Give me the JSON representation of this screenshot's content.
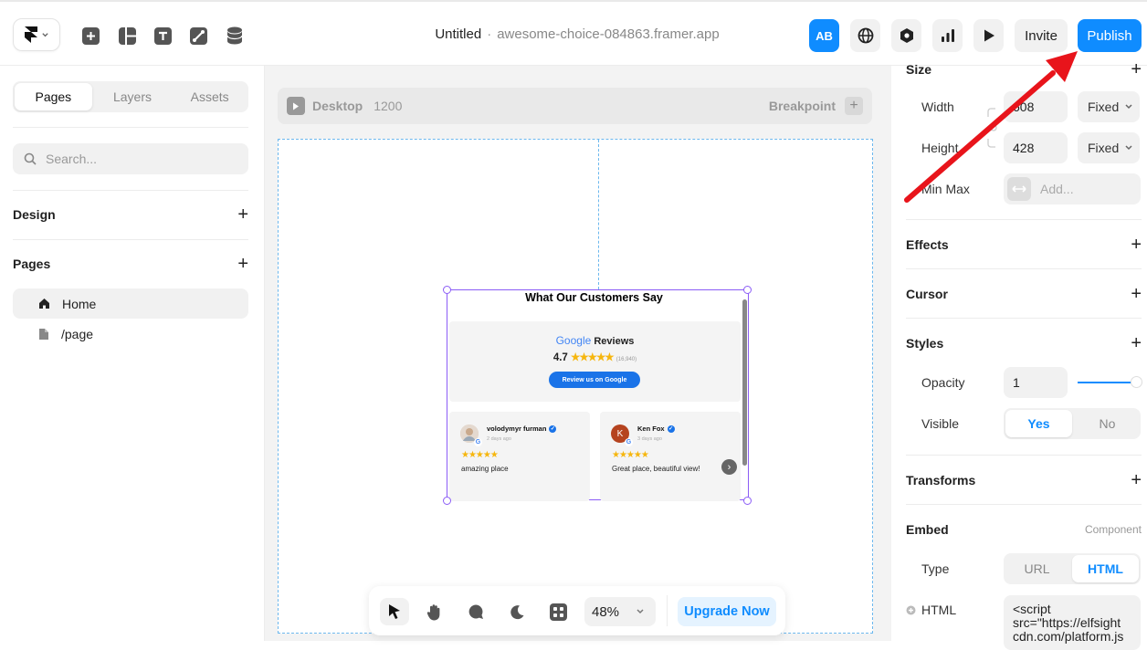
{
  "header": {
    "project_name": "Untitled",
    "separator": "·",
    "project_url": "awesome-choice-084863.framer.app",
    "avatar": "AB",
    "invite_label": "Invite",
    "publish_label": "Publish",
    "tools": [
      "insert-icon",
      "layout-icon",
      "text-icon",
      "vector-icon",
      "cms-icon"
    ]
  },
  "left_panel": {
    "tabs": [
      "Pages",
      "Layers",
      "Assets"
    ],
    "active_tab": "Pages",
    "search_placeholder": "Search...",
    "design_label": "Design",
    "pages_label": "Pages",
    "pages": [
      {
        "label": "Home",
        "icon": "home-icon",
        "active": true
      },
      {
        "label": "/page",
        "icon": "page-icon",
        "active": false
      }
    ]
  },
  "canvas": {
    "breakpoint_name": "Desktop",
    "breakpoint_width": "1200",
    "breakpoint_label": "Breakpoint",
    "widget": {
      "title": "What Our Customers Say",
      "google_word": "Google",
      "reviews_word": "Reviews",
      "rating": "4.7",
      "stars": "★★★★★",
      "review_count": "(16,940)",
      "review_button": "Review us on Google",
      "reviews": [
        {
          "name": "volodymyr furman",
          "date": "2 days ago",
          "stars": "★★★★★",
          "text": "amazing place",
          "avatar_letter": "",
          "avatar_color": "#d8c8b8"
        },
        {
          "name": "Ken Fox",
          "date": "3 days ago",
          "stars": "★★★★★",
          "text": "Great place, beautiful view!",
          "avatar_letter": "K",
          "avatar_color": "#b5431f"
        }
      ]
    },
    "toolbar": {
      "zoom": "48%",
      "upgrade_label": "Upgrade Now"
    }
  },
  "right_panel": {
    "size_label": "Size",
    "width_label": "Width",
    "width_value": "608",
    "width_mode": "Fixed",
    "height_label": "Height",
    "height_value": "428",
    "height_mode": "Fixed",
    "minmax_label": "Min Max",
    "minmax_placeholder": "Add...",
    "effects_label": "Effects",
    "cursor_label": "Cursor",
    "styles_label": "Styles",
    "opacity_label": "Opacity",
    "opacity_value": "1",
    "visible_label": "Visible",
    "visible_yes": "Yes",
    "visible_no": "No",
    "transforms_label": "Transforms",
    "embed_label": "Embed",
    "embed_tag": "Component",
    "type_label": "Type",
    "type_url": "URL",
    "type_html": "HTML",
    "html_label": "HTML",
    "html_value": "<script src=\"https://elfsight cdn.com/platform.js"
  },
  "colors": {
    "accent": "#0f8cff",
    "selection": "#8b5cf6",
    "annotation_arrow": "#e8141b"
  }
}
